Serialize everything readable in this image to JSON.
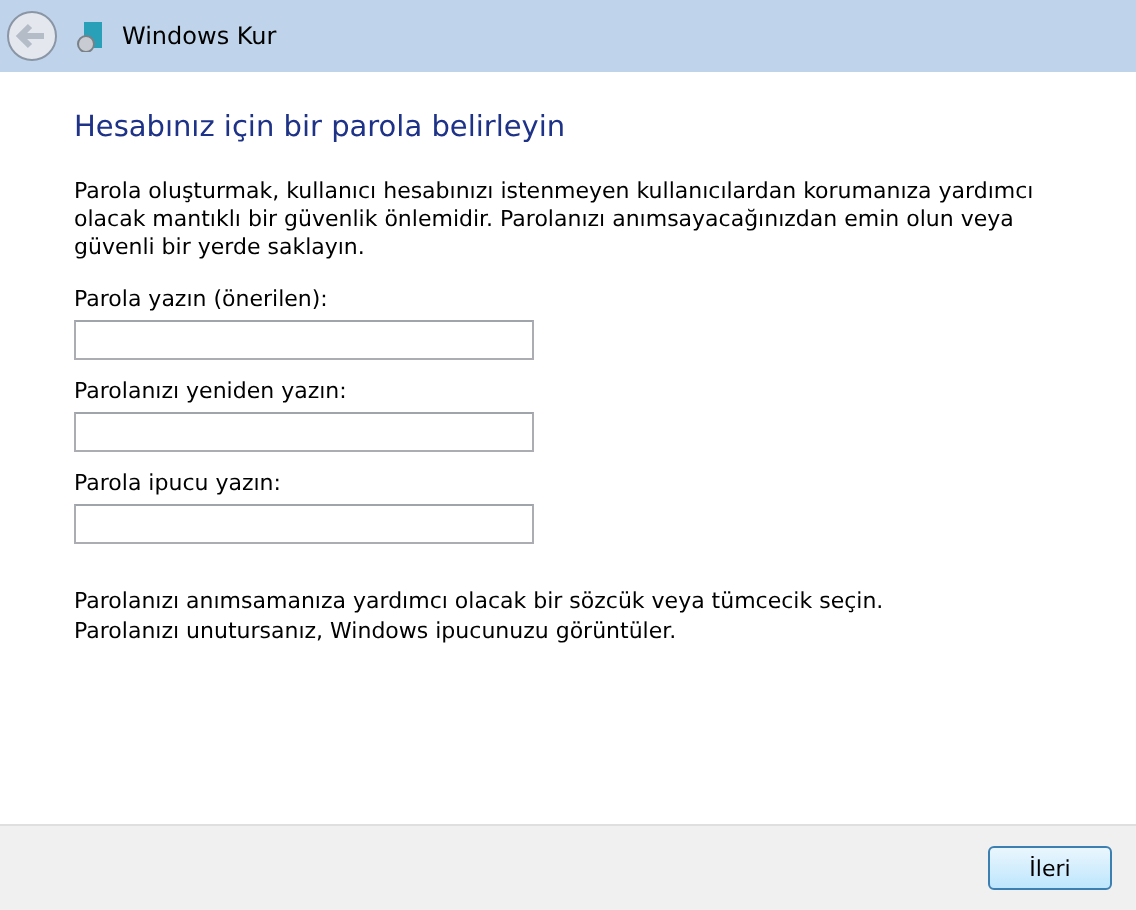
{
  "window": {
    "title": "Windows Kur"
  },
  "heading": "Hesabınız için bir parola belirleyin",
  "description": "Parola oluşturmak, kullanıcı hesabınızı istenmeyen kullanıcılardan korumanıza yardımcı olacak mantıklı bir güvenlik önlemidir. Parolanızı anımsayacağınızdan emin olun veya güvenli bir yerde saklayın.",
  "fields": [
    {
      "label": "Parola yazın (önerilen):"
    },
    {
      "label": "Parolanızı yeniden yazın:"
    },
    {
      "label": "Parola ipucu yazın:"
    }
  ],
  "hint_lines": [
    "Parolanızı anımsamanıza yardımcı olacak bir sözcük veya tümcecik seçin.",
    "Parolanızı unutursanız, Windows ipucunuzu görüntüler."
  ],
  "buttons": [
    {
      "label": "İleri"
    }
  ]
}
